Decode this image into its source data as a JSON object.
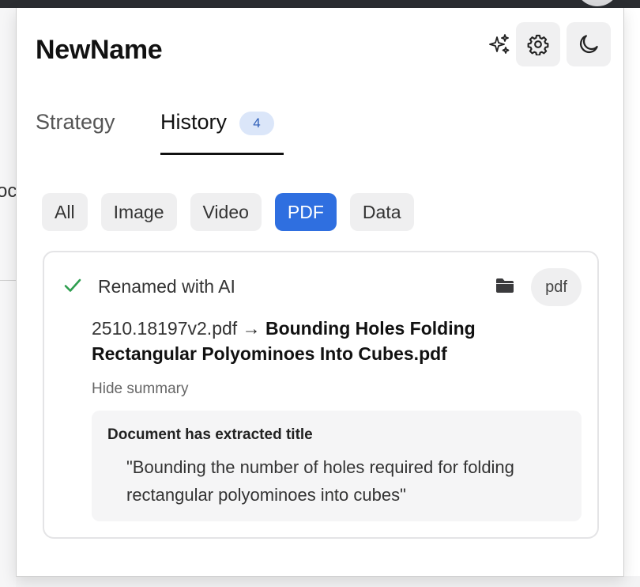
{
  "app": {
    "title": "NewName"
  },
  "tabs": [
    {
      "label": "Strategy"
    },
    {
      "label": "History",
      "count": "4"
    }
  ],
  "filters": [
    "All",
    "Image",
    "Video",
    "PDF",
    "Data"
  ],
  "active_filter": "PDF",
  "history_item": {
    "status": "Renamed with AI",
    "type_badge": "pdf",
    "old_name": "2510.18197v2.pdf",
    "arrow": "→",
    "new_name": "Bounding Holes Folding Rectangular Polyominoes Into Cubes.pdf",
    "summary_toggle": "Hide summary",
    "summary_heading": "Document has extracted title",
    "summary_quote": "\"Bounding the number of holes required for folding rectangular polyominoes into cubes\""
  },
  "icons": {
    "ai": "sparkles-icon",
    "settings": "gear-icon",
    "theme": "moon-icon",
    "status": "check-icon",
    "open_folder": "folder-icon"
  },
  "colors": {
    "accent": "#2f6fe0",
    "success": "#2e9e4f",
    "badge_bg": "#dbe6f9",
    "badge_text": "#2f5fb8"
  },
  "background": {
    "partial_text": "oc"
  }
}
